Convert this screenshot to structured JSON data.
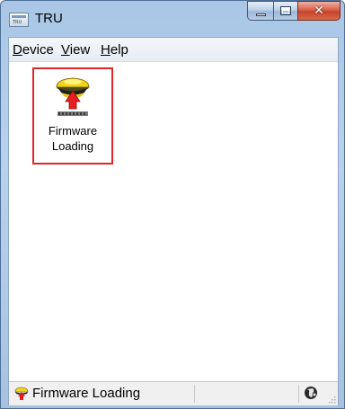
{
  "window": {
    "title": "TRU",
    "app_icon_text": "TRU"
  },
  "menu": [
    {
      "label": "Device"
    },
    {
      "label": "View"
    },
    {
      "label": "Help"
    }
  ],
  "tile": {
    "label_line1": "Firmware",
    "label_line2": "Loading",
    "icon": "firmware-loading-icon"
  },
  "status": {
    "text": "Firmware Loading",
    "icon": "firmware-loading-icon",
    "right_icon": "globe-icon"
  },
  "colors": {
    "highlight_border": "#e0262a",
    "titlebar": "#a9c6e6",
    "close_button": "#c8432a"
  }
}
